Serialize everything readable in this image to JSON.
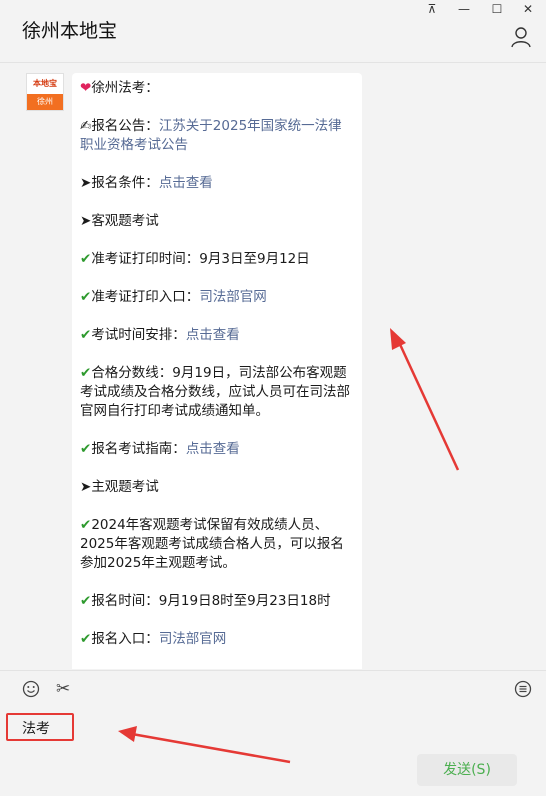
{
  "window": {
    "title": "徐州本地宝",
    "controls": {
      "pin": "⊼",
      "minimize": "—",
      "maximize": "☐",
      "close": "✕"
    }
  },
  "avatar": {
    "top_text": "本地宝",
    "bottom_text": "徐州"
  },
  "message": {
    "heading": "徐州法考：",
    "items": [
      {
        "icon": "writing-hand-icon",
        "label": "报名公告：",
        "link": "江苏关于2025年国家统一法律职业资格考试公告"
      },
      {
        "icon": "arrow-icon",
        "label": "报名条件：",
        "link": "点击查看"
      },
      {
        "icon": "arrow-icon",
        "label": "客观题考试",
        "link": ""
      },
      {
        "icon": "check-icon",
        "label": "准考证打印时间：9月3日至9月12日",
        "link": ""
      },
      {
        "icon": "check-icon",
        "label": "准考证打印入口：",
        "link": "司法部官网"
      },
      {
        "icon": "check-icon",
        "label": "考试时间安排：",
        "link": "点击查看"
      },
      {
        "icon": "check-icon",
        "label": "合格分数线：9月19日，司法部公布客观题考试成绩及合格分数线，应试人员可在司法部官网自行打印考试成绩通知单。",
        "link": ""
      },
      {
        "icon": "check-icon",
        "label": "报名考试指南：",
        "link": "点击查看"
      },
      {
        "icon": "arrow-icon",
        "label": "主观题考试",
        "link": ""
      },
      {
        "icon": "check-icon",
        "label": "2024年客观题考试保留有效成绩人员、2025年客观题考试成绩合格人员，可以报名参加2025年主观题考试。",
        "link": ""
      },
      {
        "icon": "check-icon",
        "label": "报名时间：9月19日8时至9月23日18时",
        "link": ""
      },
      {
        "icon": "check-icon",
        "label": "报名入口：",
        "link": "司法部官网"
      }
    ]
  },
  "input": {
    "value": "法考"
  },
  "send_button": {
    "label": "发送(S)"
  },
  "colors": {
    "link": "#576b95",
    "annotation": "#e53935",
    "send_text": "#4caf50"
  }
}
